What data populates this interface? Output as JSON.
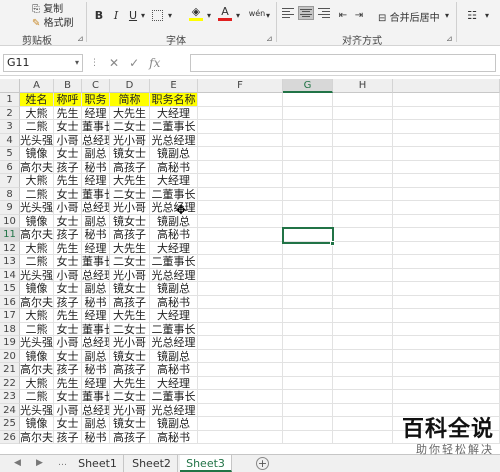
{
  "ribbon": {
    "clipboard": {
      "copy_label": "复制",
      "format_painter_label": "格式刷",
      "group_label": "剪贴板"
    },
    "font": {
      "bold": "B",
      "italic": "I",
      "underline": "U",
      "underline_dropdown": "▾",
      "phonetic": "wén",
      "group_label": "字体"
    },
    "alignment": {
      "merge_label": "合并后居中",
      "group_label": "对齐方式"
    }
  },
  "formula_bar": {
    "name_box": "G11",
    "formula": ""
  },
  "columns": [
    "A",
    "B",
    "C",
    "D",
    "E",
    "F",
    "G",
    "H"
  ],
  "headers": [
    "姓名",
    "称呼",
    "职务",
    "简称",
    "职务名称"
  ],
  "rows": [
    [
      "大熊",
      "先生",
      "经理",
      "大先生",
      "大经理"
    ],
    [
      "二熊",
      "女士",
      "董事长",
      "二女士",
      "二董事长"
    ],
    [
      "光头强",
      "小哥",
      "总经理",
      "光小哥",
      "光总经理"
    ],
    [
      "镜像",
      "女士",
      "副总",
      "镜女士",
      "镜副总"
    ],
    [
      "高尔夫",
      "孩子",
      "秘书",
      "高孩子",
      "高秘书"
    ],
    [
      "大熊",
      "先生",
      "经理",
      "大先生",
      "大经理"
    ],
    [
      "二熊",
      "女士",
      "董事长",
      "二女士",
      "二董事长"
    ],
    [
      "光头强",
      "小哥",
      "总经理",
      "光小哥",
      "光总经理"
    ],
    [
      "镜像",
      "女士",
      "副总",
      "镜女士",
      "镜副总"
    ],
    [
      "高尔夫",
      "孩子",
      "秘书",
      "高孩子",
      "高秘书"
    ],
    [
      "大熊",
      "先生",
      "经理",
      "大先生",
      "大经理"
    ],
    [
      "二熊",
      "女士",
      "董事长",
      "二女士",
      "二董事长"
    ],
    [
      "光头强",
      "小哥",
      "总经理",
      "光小哥",
      "光总经理"
    ],
    [
      "镜像",
      "女士",
      "副总",
      "镜女士",
      "镜副总"
    ],
    [
      "高尔夫",
      "孩子",
      "秘书",
      "高孩子",
      "高秘书"
    ],
    [
      "大熊",
      "先生",
      "经理",
      "大先生",
      "大经理"
    ],
    [
      "二熊",
      "女士",
      "董事长",
      "二女士",
      "二董事长"
    ],
    [
      "光头强",
      "小哥",
      "总经理",
      "光小哥",
      "光总经理"
    ],
    [
      "镜像",
      "女士",
      "副总",
      "镜女士",
      "镜副总"
    ],
    [
      "高尔夫",
      "孩子",
      "秘书",
      "高孩子",
      "高秘书"
    ],
    [
      "大熊",
      "先生",
      "经理",
      "大先生",
      "大经理"
    ],
    [
      "二熊",
      "女士",
      "董事长",
      "二女士",
      "二董事长"
    ],
    [
      "光头强",
      "小哥",
      "总经理",
      "光小哥",
      "光总经理"
    ],
    [
      "镜像",
      "女士",
      "副总",
      "镜女士",
      "镜副总"
    ],
    [
      "高尔夫",
      "孩子",
      "秘书",
      "高孩子",
      "高秘书"
    ]
  ],
  "row_numbers": [
    "1",
    "2",
    "3",
    "4",
    "5",
    "6",
    "7",
    "8",
    "9",
    "10",
    "11",
    "12",
    "13",
    "14",
    "15",
    "16",
    "17",
    "18",
    "19",
    "20",
    "21",
    "22",
    "23",
    "24",
    "25",
    "26"
  ],
  "selected_cell": "G11",
  "sheets": [
    {
      "name": "Sheet1",
      "active": false
    },
    {
      "name": "Sheet2",
      "active": false
    },
    {
      "name": "Sheet3",
      "active": true
    }
  ],
  "add_sheet_label": "+",
  "watermark": {
    "title": "百科全说",
    "subtitle": "助你轻松解决"
  },
  "colors": {
    "header_fill": "#ffff00",
    "accent": "#217346"
  }
}
